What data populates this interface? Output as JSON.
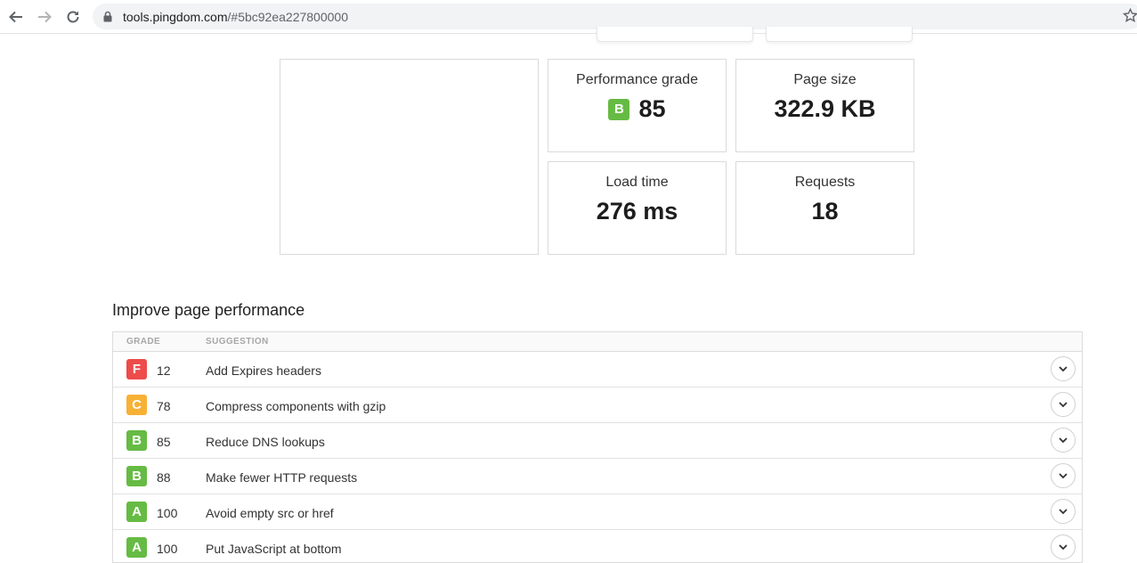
{
  "browser": {
    "url_host": "tools.pingdom.com",
    "url_rest": "/#5bc92ea227800000",
    "icons": [
      "back-icon",
      "forward-icon",
      "reload-icon",
      "lock-icon",
      "star-icon"
    ]
  },
  "summary": {
    "performance_grade": {
      "label": "Performance grade",
      "grade": "B",
      "value": "85"
    },
    "page_size": {
      "label": "Page size",
      "value": "322.9 KB"
    },
    "load_time": {
      "label": "Load time",
      "value": "276 ms"
    },
    "requests": {
      "label": "Requests",
      "value": "18"
    }
  },
  "improve": {
    "title": "Improve page performance",
    "headers": {
      "grade": "GRADE",
      "suggestion": "SUGGESTION"
    },
    "rows": [
      {
        "grade": "F",
        "score": "12",
        "suggestion": "Add Expires headers"
      },
      {
        "grade": "C",
        "score": "78",
        "suggestion": "Compress components with gzip"
      },
      {
        "grade": "B",
        "score": "85",
        "suggestion": "Reduce DNS lookups"
      },
      {
        "grade": "B",
        "score": "88",
        "suggestion": "Make fewer HTTP requests"
      },
      {
        "grade": "A",
        "score": "100",
        "suggestion": "Avoid empty src or href"
      },
      {
        "grade": "A",
        "score": "100",
        "suggestion": "Put JavaScript at bottom"
      }
    ]
  },
  "colors": {
    "grade_A": "#66bb44",
    "grade_B": "#66bb44",
    "grade_C": "#f7b135",
    "grade_F": "#ee4b4b"
  }
}
